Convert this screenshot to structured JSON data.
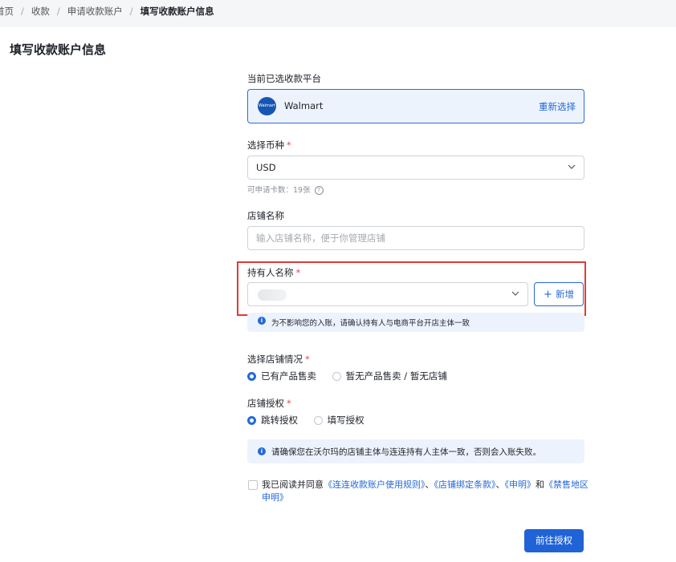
{
  "breadcrumb": {
    "items": [
      "首页",
      "收款",
      "申请收款账户",
      "填写收款账户信息"
    ]
  },
  "page": {
    "title": "填写收款账户信息"
  },
  "platform": {
    "label": "当前已选收款平台",
    "logo_text": "Walmart",
    "name": "Walmart",
    "reselect": "重新选择"
  },
  "currency": {
    "label": "选择币种",
    "required": "*",
    "value": "USD",
    "helper": "可申请卡数：19张",
    "help_icon": "?"
  },
  "store_name": {
    "label": "店铺名称",
    "placeholder": "输入店铺名称，便于你管理店铺"
  },
  "holder": {
    "label": "持有人名称",
    "required": "*",
    "add_label": "新增",
    "add_plus": "+",
    "notice": "为不影响您的入账，请确认持有人与电商平台开店主体一致",
    "info_icon": "i"
  },
  "store_status": {
    "label": "选择店铺情况",
    "required": "*",
    "options": [
      "已有产品售卖",
      "暂无产品售卖 / 暂无店铺"
    ],
    "selected": 0
  },
  "store_auth": {
    "label": "店铺授权",
    "required": "*",
    "options": [
      "跳转授权",
      "填写授权"
    ],
    "selected": 0,
    "notice": "请确保您在沃尔玛的店铺主体与连连持有人主体一致，否则会入账失败。",
    "info_icon": "i"
  },
  "agreement": {
    "prefix": "我已阅读并同意",
    "link1": "《连连收款账户使用规则》",
    "sep1": "、",
    "link2": "《店铺绑定条款》",
    "sep2": "、",
    "link3": "《申明》",
    "and": "和",
    "link4": "《禁售地区申明》"
  },
  "submit": {
    "label": "前往授权"
  },
  "colors": {
    "primary": "#2469d8",
    "highlight": "#e03a3a",
    "notice_bg": "#edf3fd"
  }
}
